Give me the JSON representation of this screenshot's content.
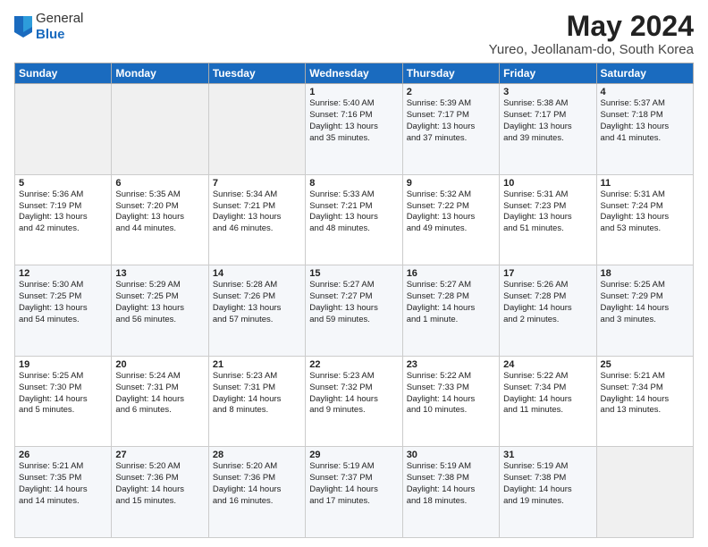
{
  "header": {
    "logo_line1": "General",
    "logo_line2": "Blue",
    "month_year": "May 2024",
    "location": "Yureo, Jeollanam-do, South Korea"
  },
  "days_of_week": [
    "Sunday",
    "Monday",
    "Tuesday",
    "Wednesday",
    "Thursday",
    "Friday",
    "Saturday"
  ],
  "weeks": [
    [
      {
        "day": "",
        "info": ""
      },
      {
        "day": "",
        "info": ""
      },
      {
        "day": "",
        "info": ""
      },
      {
        "day": "1",
        "info": "Sunrise: 5:40 AM\nSunset: 7:16 PM\nDaylight: 13 hours\nand 35 minutes."
      },
      {
        "day": "2",
        "info": "Sunrise: 5:39 AM\nSunset: 7:17 PM\nDaylight: 13 hours\nand 37 minutes."
      },
      {
        "day": "3",
        "info": "Sunrise: 5:38 AM\nSunset: 7:17 PM\nDaylight: 13 hours\nand 39 minutes."
      },
      {
        "day": "4",
        "info": "Sunrise: 5:37 AM\nSunset: 7:18 PM\nDaylight: 13 hours\nand 41 minutes."
      }
    ],
    [
      {
        "day": "5",
        "info": "Sunrise: 5:36 AM\nSunset: 7:19 PM\nDaylight: 13 hours\nand 42 minutes."
      },
      {
        "day": "6",
        "info": "Sunrise: 5:35 AM\nSunset: 7:20 PM\nDaylight: 13 hours\nand 44 minutes."
      },
      {
        "day": "7",
        "info": "Sunrise: 5:34 AM\nSunset: 7:21 PM\nDaylight: 13 hours\nand 46 minutes."
      },
      {
        "day": "8",
        "info": "Sunrise: 5:33 AM\nSunset: 7:21 PM\nDaylight: 13 hours\nand 48 minutes."
      },
      {
        "day": "9",
        "info": "Sunrise: 5:32 AM\nSunset: 7:22 PM\nDaylight: 13 hours\nand 49 minutes."
      },
      {
        "day": "10",
        "info": "Sunrise: 5:31 AM\nSunset: 7:23 PM\nDaylight: 13 hours\nand 51 minutes."
      },
      {
        "day": "11",
        "info": "Sunrise: 5:31 AM\nSunset: 7:24 PM\nDaylight: 13 hours\nand 53 minutes."
      }
    ],
    [
      {
        "day": "12",
        "info": "Sunrise: 5:30 AM\nSunset: 7:25 PM\nDaylight: 13 hours\nand 54 minutes."
      },
      {
        "day": "13",
        "info": "Sunrise: 5:29 AM\nSunset: 7:25 PM\nDaylight: 13 hours\nand 56 minutes."
      },
      {
        "day": "14",
        "info": "Sunrise: 5:28 AM\nSunset: 7:26 PM\nDaylight: 13 hours\nand 57 minutes."
      },
      {
        "day": "15",
        "info": "Sunrise: 5:27 AM\nSunset: 7:27 PM\nDaylight: 13 hours\nand 59 minutes."
      },
      {
        "day": "16",
        "info": "Sunrise: 5:27 AM\nSunset: 7:28 PM\nDaylight: 14 hours\nand 1 minute."
      },
      {
        "day": "17",
        "info": "Sunrise: 5:26 AM\nSunset: 7:28 PM\nDaylight: 14 hours\nand 2 minutes."
      },
      {
        "day": "18",
        "info": "Sunrise: 5:25 AM\nSunset: 7:29 PM\nDaylight: 14 hours\nand 3 minutes."
      }
    ],
    [
      {
        "day": "19",
        "info": "Sunrise: 5:25 AM\nSunset: 7:30 PM\nDaylight: 14 hours\nand 5 minutes."
      },
      {
        "day": "20",
        "info": "Sunrise: 5:24 AM\nSunset: 7:31 PM\nDaylight: 14 hours\nand 6 minutes."
      },
      {
        "day": "21",
        "info": "Sunrise: 5:23 AM\nSunset: 7:31 PM\nDaylight: 14 hours\nand 8 minutes."
      },
      {
        "day": "22",
        "info": "Sunrise: 5:23 AM\nSunset: 7:32 PM\nDaylight: 14 hours\nand 9 minutes."
      },
      {
        "day": "23",
        "info": "Sunrise: 5:22 AM\nSunset: 7:33 PM\nDaylight: 14 hours\nand 10 minutes."
      },
      {
        "day": "24",
        "info": "Sunrise: 5:22 AM\nSunset: 7:34 PM\nDaylight: 14 hours\nand 11 minutes."
      },
      {
        "day": "25",
        "info": "Sunrise: 5:21 AM\nSunset: 7:34 PM\nDaylight: 14 hours\nand 13 minutes."
      }
    ],
    [
      {
        "day": "26",
        "info": "Sunrise: 5:21 AM\nSunset: 7:35 PM\nDaylight: 14 hours\nand 14 minutes."
      },
      {
        "day": "27",
        "info": "Sunrise: 5:20 AM\nSunset: 7:36 PM\nDaylight: 14 hours\nand 15 minutes."
      },
      {
        "day": "28",
        "info": "Sunrise: 5:20 AM\nSunset: 7:36 PM\nDaylight: 14 hours\nand 16 minutes."
      },
      {
        "day": "29",
        "info": "Sunrise: 5:19 AM\nSunset: 7:37 PM\nDaylight: 14 hours\nand 17 minutes."
      },
      {
        "day": "30",
        "info": "Sunrise: 5:19 AM\nSunset: 7:38 PM\nDaylight: 14 hours\nand 18 minutes."
      },
      {
        "day": "31",
        "info": "Sunrise: 5:19 AM\nSunset: 7:38 PM\nDaylight: 14 hours\nand 19 minutes."
      },
      {
        "day": "",
        "info": ""
      }
    ]
  ]
}
